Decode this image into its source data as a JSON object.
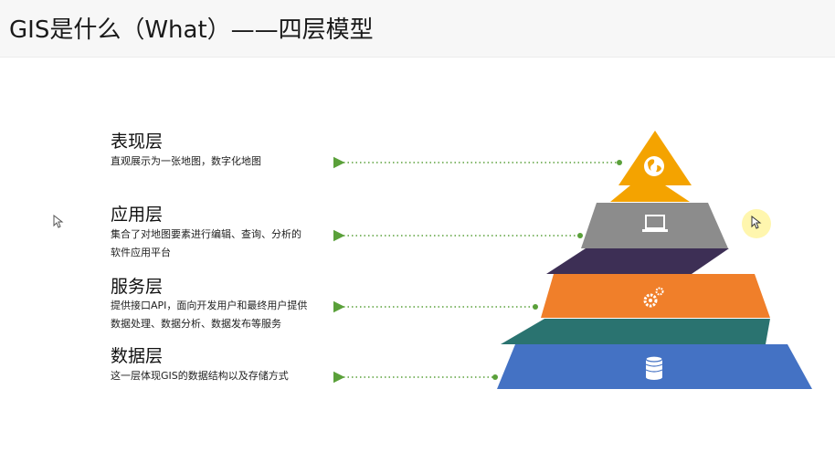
{
  "title": "GIS是什么（What）——四层模型",
  "layers": [
    {
      "name": "表现层",
      "desc": [
        "直观展示为一张地图，数字化地图"
      ],
      "color": "#f4a300",
      "icon": "globe-icon"
    },
    {
      "name": "应用层",
      "desc": [
        "集合了对地图要素进行编辑、查询、分析的",
        "软件应用平台"
      ],
      "color": "#8c8c8c",
      "icon": "laptop-icon"
    },
    {
      "name": "服务层",
      "desc": [
        "提供接口API，面向开发用户和最终用户提供",
        "数据处理、数据分析、数据发布等服务"
      ],
      "color": "#f07f2a",
      "icon": "gears-icon"
    },
    {
      "name": "数据层",
      "desc": [
        "这一层体现GIS的数据结构以及存储方式"
      ],
      "color": "#4472c4",
      "icon": "database-icon"
    }
  ],
  "connector_colors": [
    "#f4a300",
    "#3d2f55",
    "#2a7370"
  ],
  "arrow_color": "#5aa03a"
}
